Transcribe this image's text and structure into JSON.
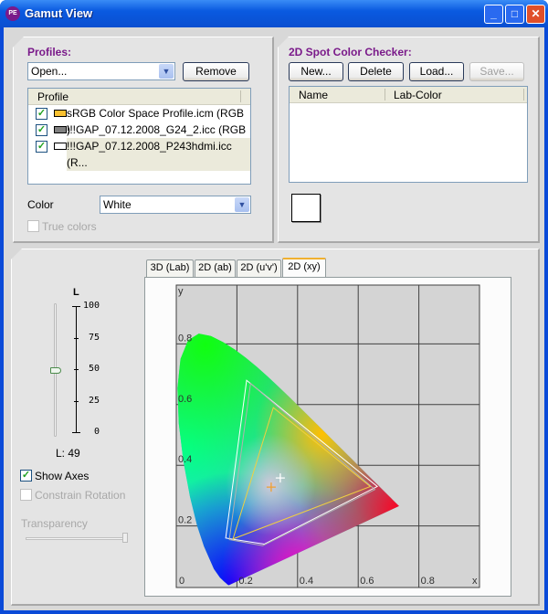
{
  "window": {
    "title": "Gamut View",
    "minimize": "_",
    "maximize": "□",
    "close": "✕"
  },
  "profiles": {
    "header": "Profiles:",
    "open_combo": "Open...",
    "remove": "Remove",
    "column": "Profile",
    "items": [
      {
        "label": "sRGB Color Space Profile.icm (RGB )",
        "checked": true,
        "swatch": "#f8c030"
      },
      {
        "label": "!!!GAP_07.12.2008_G24_2.icc (RGB )",
        "checked": true,
        "swatch": "#808080"
      },
      {
        "label": "!!!GAP_07.12.2008_P243hdmi.icc (R...",
        "checked": true,
        "swatch": "#ffffff"
      }
    ],
    "color_label": "Color",
    "color_value": "White",
    "true_colors": "True colors"
  },
  "spot": {
    "header": "2D Spot Color Checker:",
    "new": "New...",
    "delete": "Delete",
    "load": "Load...",
    "save": "Save...",
    "columns": [
      "Name",
      "Lab-Color"
    ],
    "swatch_color": "#ffffff"
  },
  "view": {
    "tabs": [
      "3D (Lab)",
      "2D (ab)",
      "2D (u'v')",
      "2D (xy)"
    ],
    "active_tab": "2D (xy)",
    "l_axis": {
      "title": "L",
      "ticks": [
        "100",
        "75",
        "50",
        "25",
        "0"
      ]
    },
    "l_value": 49,
    "l_readout": "L: 49",
    "show_axes": "Show Axes",
    "constrain_rotation": "Constrain Rotation",
    "transparency": "Transparency",
    "transparency_level": 1.0
  },
  "chart_data": {
    "type": "line",
    "xlabel": "x",
    "ylabel": "y",
    "xlim": [
      0,
      1
    ],
    "ylim": [
      0,
      1
    ],
    "x_ticks": [
      "0",
      "0.2",
      "0.4",
      "0.6",
      "0.8"
    ],
    "y_ticks": [
      "0.2",
      "0.4",
      "0.6",
      "0.8"
    ],
    "grid": true,
    "gamuts": [
      {
        "color": "#ffffff",
        "points": [
          [
            0.232,
            0.68
          ],
          [
            0.663,
            0.33
          ],
          [
            0.29,
            0.14
          ],
          [
            0.163,
            0.16
          ]
        ]
      },
      {
        "color": "#b0b0b0",
        "points": [
          [
            0.245,
            0.67
          ],
          [
            0.655,
            0.32
          ],
          [
            0.285,
            0.135
          ],
          [
            0.175,
            0.155
          ]
        ]
      },
      {
        "color": "#f0d040",
        "points": [
          [
            0.32,
            0.59
          ],
          [
            0.64,
            0.33
          ],
          [
            0.187,
            0.157
          ]
        ]
      }
    ],
    "white_points": [
      {
        "color": "#ffffff",
        "x": 0.343,
        "y": 0.358
      },
      {
        "color": "#f0a030",
        "x": 0.313,
        "y": 0.328
      }
    ]
  }
}
